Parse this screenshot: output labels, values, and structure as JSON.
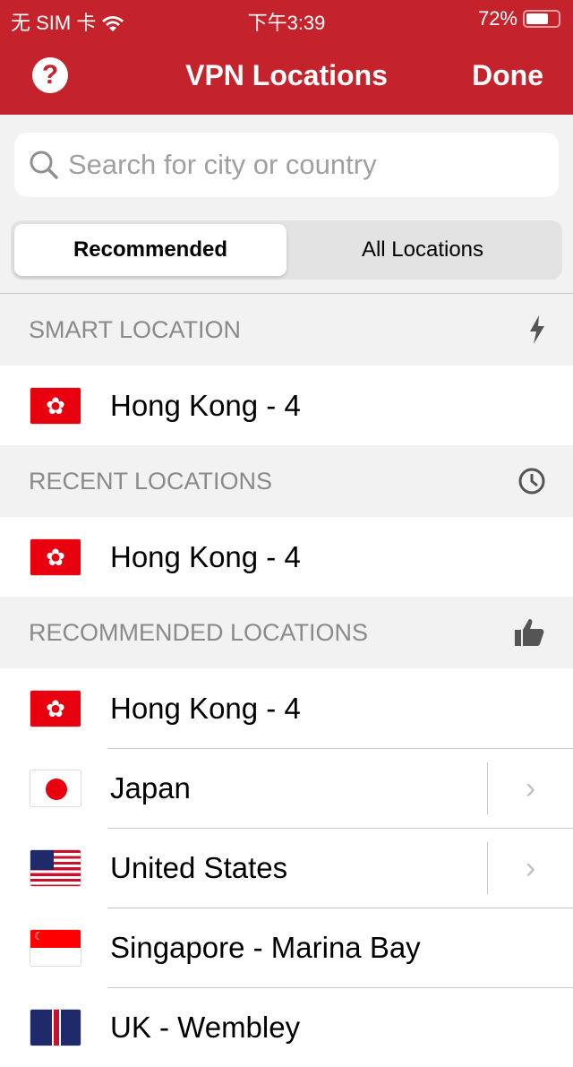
{
  "status": {
    "carrier": "无 SIM 卡",
    "time": "下午3:39",
    "battery": "72%",
    "battery_level": 0.72
  },
  "nav": {
    "title": "VPN Locations",
    "done": "Done",
    "help": "?"
  },
  "search": {
    "placeholder": "Search for city or country"
  },
  "tabs": [
    {
      "label": "Recommended",
      "selected": true
    },
    {
      "label": "All Locations",
      "selected": false
    }
  ],
  "sections": {
    "smart": {
      "title": "SMART LOCATION",
      "items": [
        {
          "name": "Hong Kong - 4",
          "flag": "hk"
        }
      ]
    },
    "recent": {
      "title": "RECENT LOCATIONS",
      "items": [
        {
          "name": "Hong Kong - 4",
          "flag": "hk"
        }
      ]
    },
    "recommended": {
      "title": "RECOMMENDED LOCATIONS",
      "items": [
        {
          "name": "Hong Kong - 4",
          "flag": "hk"
        },
        {
          "name": "Japan",
          "flag": "jp"
        },
        {
          "name": "United States",
          "flag": "us"
        },
        {
          "name": "Singapore - Marina Bay",
          "flag": "sg"
        },
        {
          "name": "UK - Wembley",
          "flag": "uk"
        }
      ]
    }
  },
  "colors": {
    "brand": "#c4232c"
  }
}
